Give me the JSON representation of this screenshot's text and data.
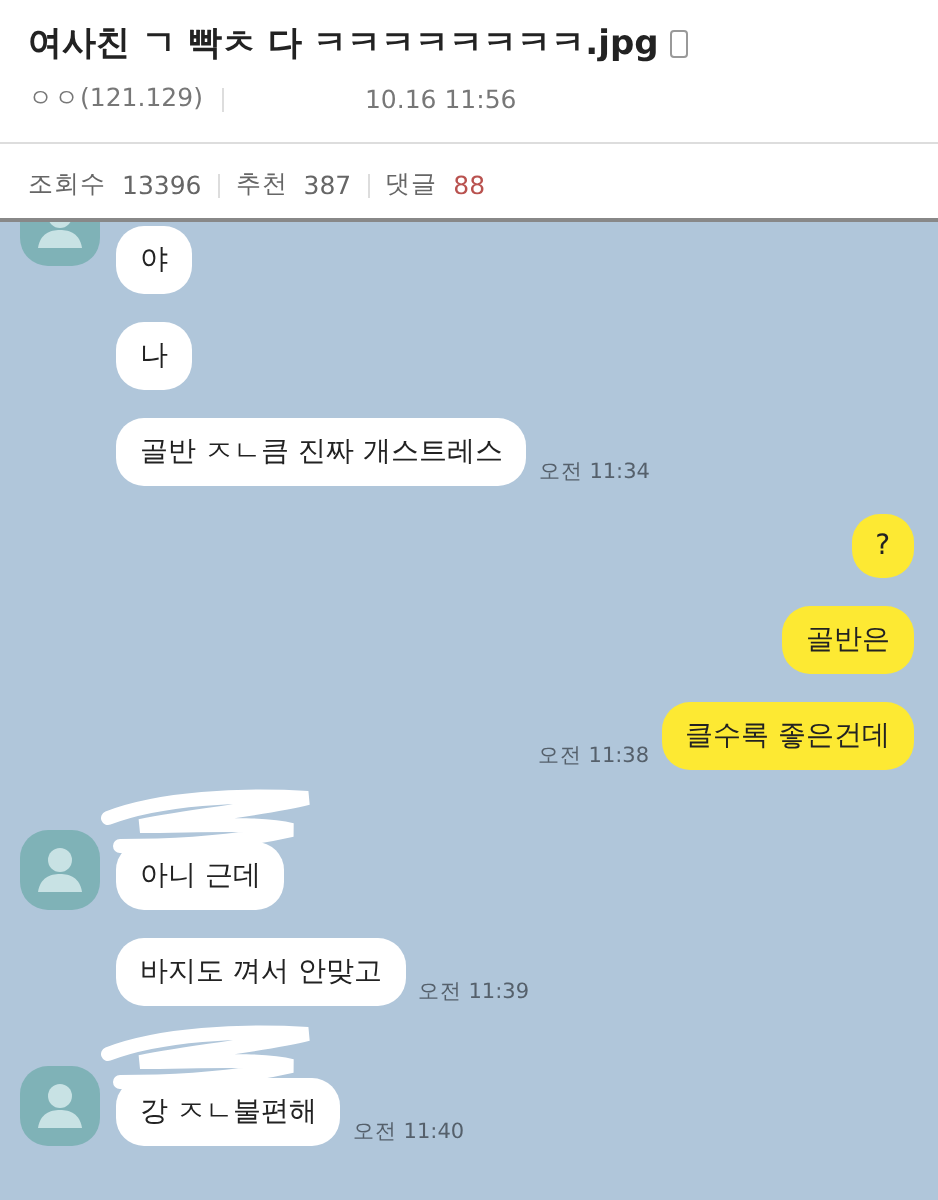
{
  "post": {
    "title": "여사친 ㄱ 빡ㅊ 다 ㅋㅋㅋㅋㅋㅋㅋㅋ.jpg",
    "author": "ㅇㅇ(121.129)",
    "date": "10.16 11:56",
    "stats": [
      {
        "label": "조회수",
        "value": "13396",
        "kind": "plain"
      },
      {
        "label": "추천",
        "value": "387",
        "kind": "plain"
      },
      {
        "label": "댓글",
        "value": "88",
        "kind": "accent"
      }
    ]
  },
  "chat": {
    "groups": [
      {
        "kind": "received",
        "avatar": true,
        "cut": true,
        "messages": [
          {
            "text": "야"
          },
          {
            "text": "나"
          },
          {
            "text": "골반 ㅈㄴ큼 진짜 개스트레스",
            "time": "오전 11:34"
          }
        ]
      },
      {
        "kind": "sent",
        "avatar": false,
        "cut": false,
        "messages": [
          {
            "text": "?"
          },
          {
            "text": "골반은"
          },
          {
            "text": "클수록 좋은건데",
            "time": "오전 11:38"
          }
        ]
      },
      {
        "kind": "received",
        "avatar": true,
        "cut": false,
        "messages": [
          {
            "text": "아니 근데"
          },
          {
            "text": "바지도 껴서 안맞고",
            "time": "오전 11:39"
          }
        ]
      },
      {
        "kind": "received",
        "avatar": true,
        "cut": false,
        "messages": [
          {
            "text": "강 ㅈㄴ불편해",
            "time": "오전 11:40"
          }
        ]
      }
    ]
  }
}
